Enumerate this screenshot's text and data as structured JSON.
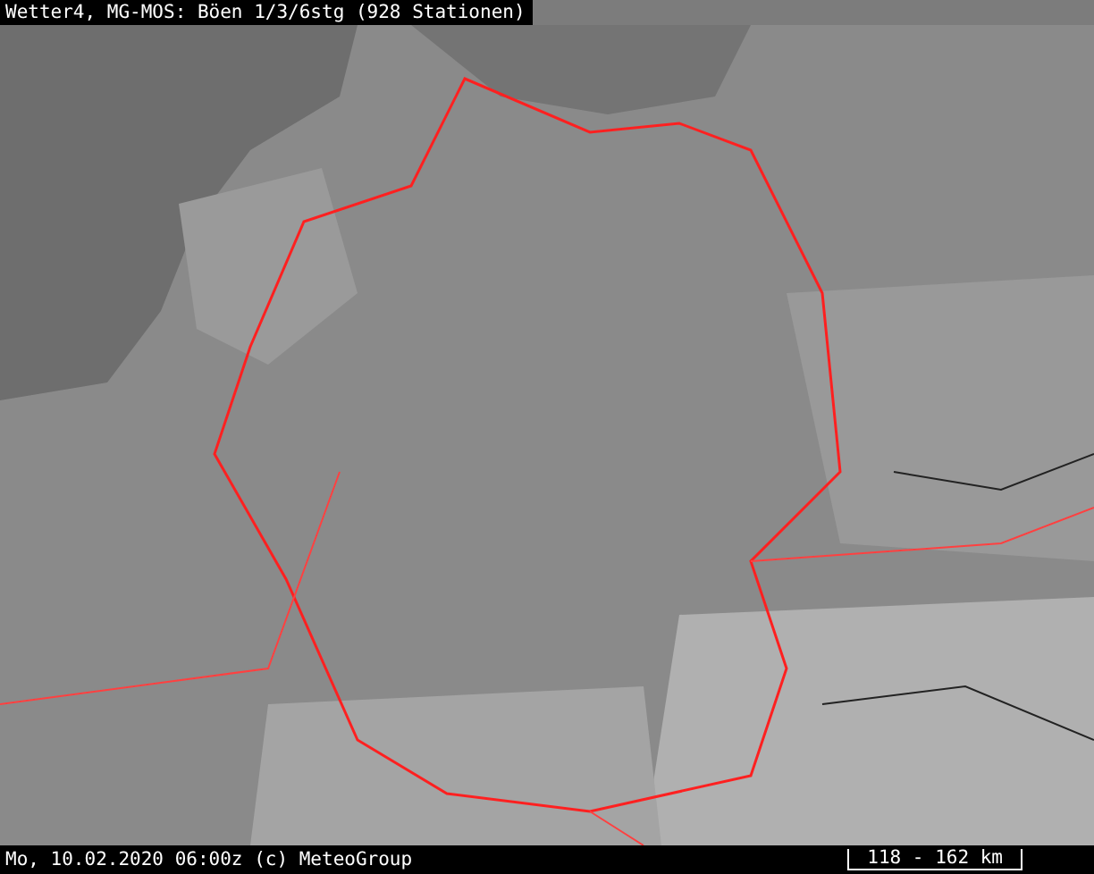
{
  "header": {
    "title": "Wetter4, MG-MOS: Böen 1/3/6stg (928 Stationen)"
  },
  "footer": {
    "caption": "Mo, 10.02.2020 06:00z (c) MeteoGroup",
    "scale": "118 - 162 km"
  }
}
